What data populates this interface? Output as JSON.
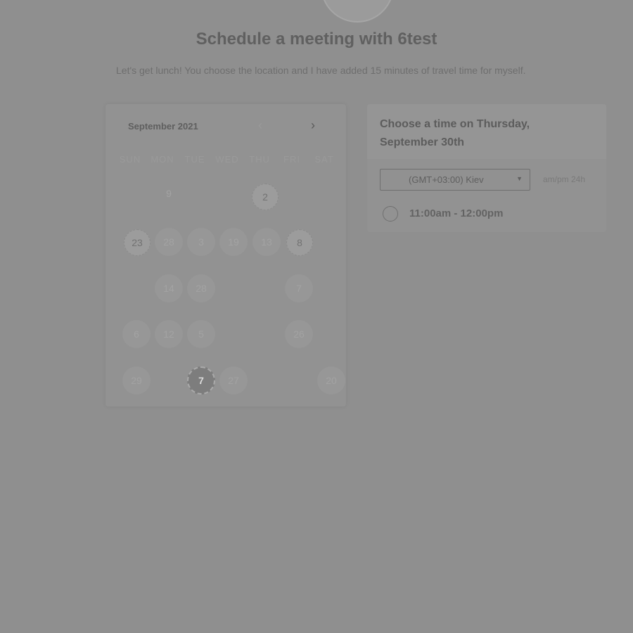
{
  "header": {
    "title": "Schedule a meeting with 6test",
    "description": "Let's get lunch! You choose the location and I have added 15 minutes of travel time for myself."
  },
  "calendar": {
    "month_label": "September 2021",
    "prev_icon": "chevron-left-icon",
    "next_icon": "chevron-right-icon",
    "weekdays": [
      "SUN",
      "MON",
      "TUE",
      "WED",
      "THU",
      "FRI",
      "SAT"
    ],
    "days": [
      {
        "label": "9",
        "state": "available"
      },
      {
        "label": "2",
        "state": "highlighted"
      },
      {
        "label": "23",
        "state": "highlighted"
      },
      {
        "label": "28",
        "state": "available"
      },
      {
        "label": "3",
        "state": "available"
      },
      {
        "label": "19",
        "state": "available"
      },
      {
        "label": "13",
        "state": "available"
      },
      {
        "label": "8",
        "state": "highlighted"
      },
      {
        "label": "14",
        "state": "available"
      },
      {
        "label": "28",
        "state": "available"
      },
      {
        "label": "7",
        "state": "available"
      },
      {
        "label": "6",
        "state": "available"
      },
      {
        "label": "12",
        "state": "available"
      },
      {
        "label": "5",
        "state": "available"
      },
      {
        "label": "26",
        "state": "available"
      },
      {
        "label": "29",
        "state": "available"
      },
      {
        "label": "7",
        "state": "selected"
      },
      {
        "label": "27",
        "state": "available"
      },
      {
        "label": "20",
        "state": "available"
      }
    ]
  },
  "time_panel": {
    "title": "Choose a time on Thursday, September 30th",
    "timezone": "(GMT+03:00) Kiev",
    "format_toggle": "am/pm 24h",
    "slots": [
      {
        "label": "11:00am - 12:00pm"
      }
    ]
  }
}
